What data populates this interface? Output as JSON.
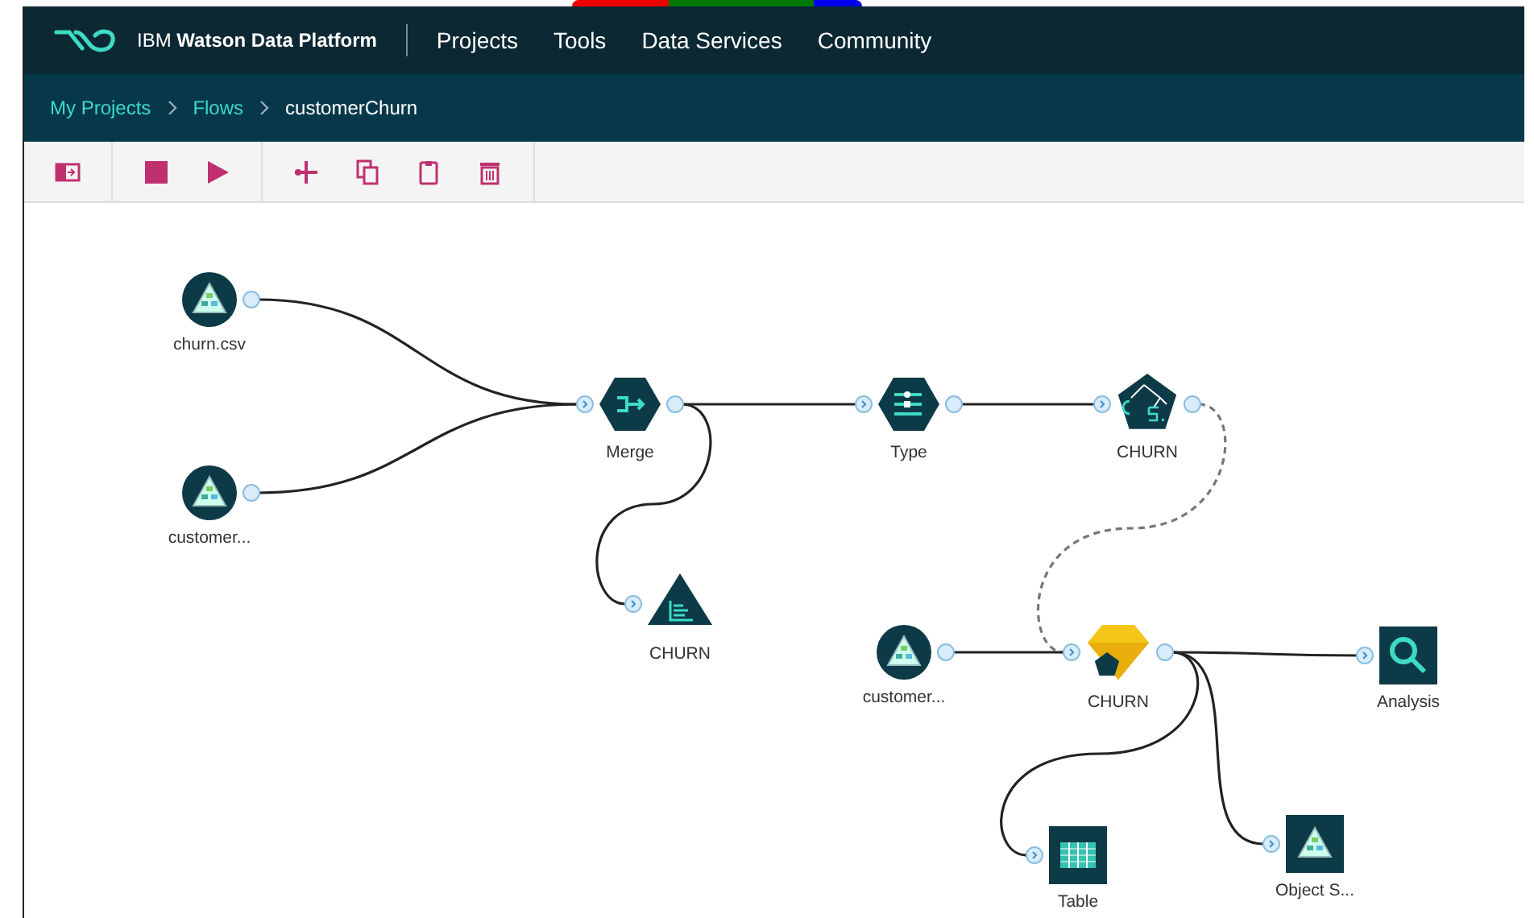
{
  "header": {
    "brand": "IBM **Watson Data Platform**",
    "nav": [
      {
        "label": "Projects"
      },
      {
        "label": "Tools"
      },
      {
        "label": "Data Services"
      },
      {
        "label": "Community"
      }
    ]
  },
  "breadcrumbs": [
    {
      "label": "My Projects",
      "current": false
    },
    {
      "label": "Flows",
      "current": false
    },
    {
      "label": "customerChurn",
      "current": true
    }
  ],
  "flow": {
    "nodes": [
      {
        "label": "churn.csv",
        "kind": "source"
      },
      {
        "label": "customer...",
        "kind": "source"
      },
      {
        "label": "Merge",
        "kind": "merge"
      },
      {
        "label": "CHURN",
        "kind": "graph"
      },
      {
        "label": "Type",
        "kind": "type"
      },
      {
        "label": "CHURN",
        "kind": "model"
      },
      {
        "label": "customer...",
        "kind": "source"
      },
      {
        "label": "CHURN",
        "kind": "nugget"
      },
      {
        "label": "Analysis",
        "kind": "analysis"
      },
      {
        "label": "Table",
        "kind": "table"
      },
      {
        "label": "Object S...",
        "kind": "export"
      }
    ]
  }
}
